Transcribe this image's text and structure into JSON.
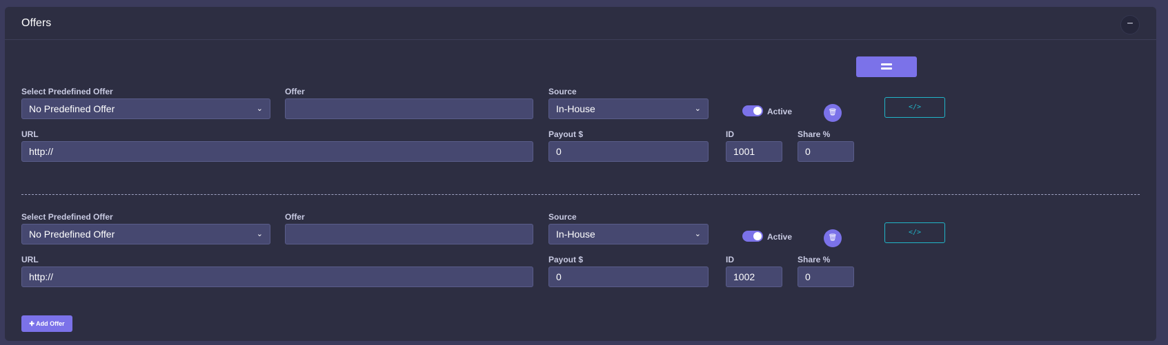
{
  "card": {
    "title": "Offers",
    "collapse_icon": "−"
  },
  "offers": [
    {
      "predefined_label": "Select Predefined Offer",
      "predefined_value": "No Predefined Offer",
      "offer_label": "Offer",
      "offer_value": "",
      "source_label": "Source",
      "source_value": "In-House",
      "active_label": "Active",
      "active": true,
      "url_label": "URL",
      "url_value": "http://",
      "payout_label": "Payout $",
      "payout_value": "0",
      "id_label": "ID",
      "id_value": "1001",
      "share_label": "Share %",
      "share_value": "0",
      "code_icon": "</>"
    },
    {
      "predefined_label": "Select Predefined Offer",
      "predefined_value": "No Predefined Offer",
      "offer_label": "Offer",
      "offer_value": "",
      "source_label": "Source",
      "source_value": "In-House",
      "active_label": "Active",
      "active": true,
      "url_label": "URL",
      "url_value": "http://",
      "payout_label": "Payout $",
      "payout_value": "0",
      "id_label": "ID",
      "id_value": "1002",
      "share_label": "Share %",
      "share_value": "0",
      "code_icon": "</>"
    }
  ],
  "add_button": {
    "label": "✚ Add Offer"
  },
  "colors": {
    "accent": "#7b72e9",
    "code_button": "#21b6c9",
    "card": "#2d2e42",
    "input": "#464870"
  }
}
